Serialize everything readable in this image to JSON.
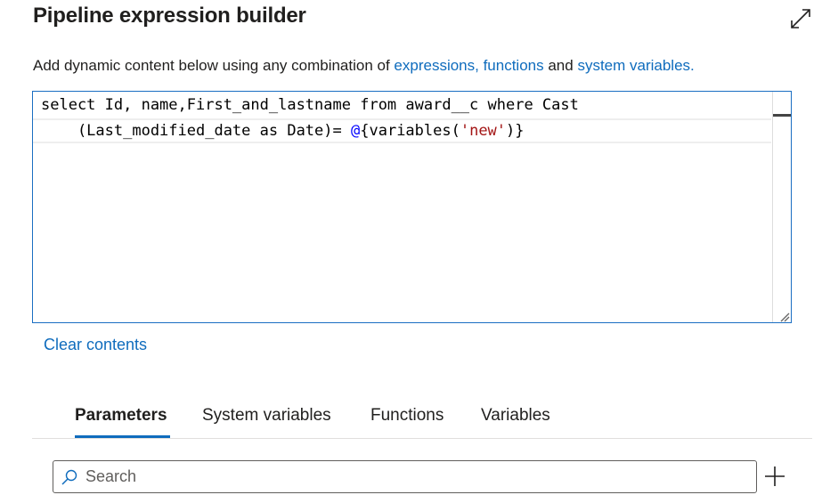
{
  "header": {
    "title": "Pipeline expression builder",
    "expand_icon": "expand-diagonal-icon"
  },
  "subtitle": {
    "prefix": "Add dynamic content below using any combination of ",
    "link_expressions": "expressions, functions",
    "middle": " and ",
    "link_system_variables": "system variables",
    "suffix": "."
  },
  "editor": {
    "line1": "select Id, name,First_and_lastname from award__c where Cast",
    "line2_prefix": "    (Last_modified_date as Date)= ",
    "line2_at": "@",
    "line2_call_open": "{variables(",
    "line2_string": "'new'",
    "line2_call_close": ")}"
  },
  "actions": {
    "clear_label": "Clear contents"
  },
  "tabs": [
    {
      "label": "Parameters",
      "active": true
    },
    {
      "label": "System variables",
      "active": false
    },
    {
      "label": "Functions",
      "active": false
    },
    {
      "label": "Variables",
      "active": false
    }
  ],
  "search": {
    "placeholder": "Search",
    "value": "",
    "icon": "search-icon"
  },
  "add_button": {
    "icon": "plus-icon"
  },
  "colors": {
    "accent": "#0f6cbd",
    "text": "#201f1e",
    "keyword_at": "#0000ff",
    "string": "#a31515"
  }
}
